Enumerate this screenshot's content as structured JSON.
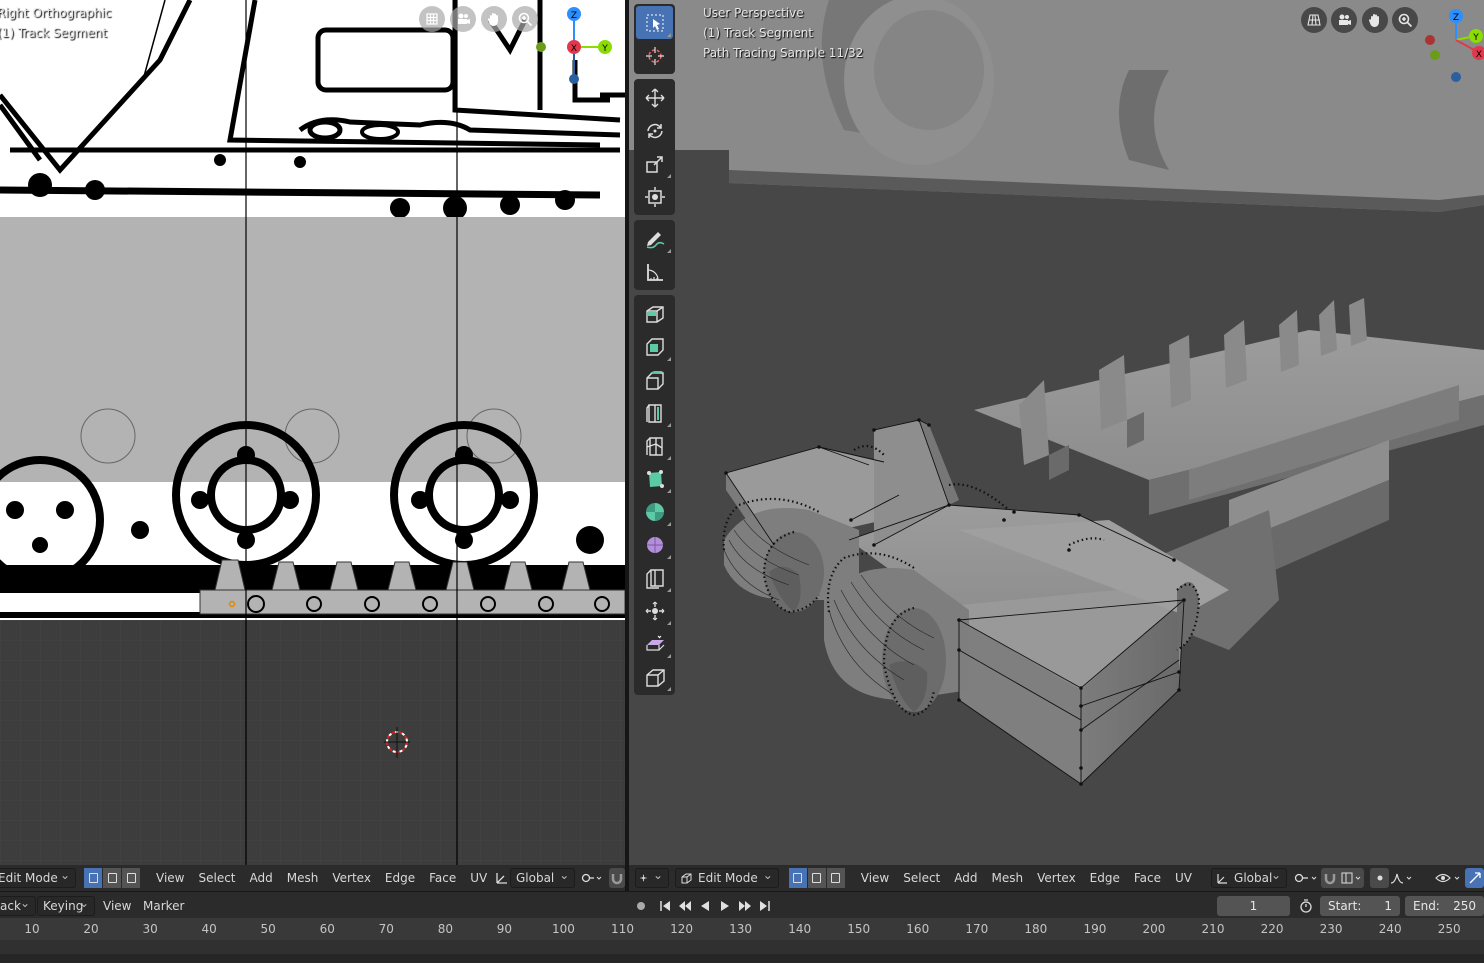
{
  "left_viewport": {
    "view_name": "Right Orthographic",
    "object_name": "(1) Track Segment",
    "nav_buttons": [
      "grid-icon",
      "camera-icon",
      "hand-icon",
      "zoom-icon"
    ],
    "gizmo_axes": [
      "Z",
      "X",
      "Y"
    ]
  },
  "right_viewport": {
    "view_name": "User Perspective",
    "object_name": "(1) Track Segment",
    "render_status": "Path Tracing Sample 11/32",
    "nav_buttons": [
      "grid-icon",
      "camera-icon",
      "hand-icon",
      "zoom-icon"
    ],
    "gizmo_axes": [
      "Z",
      "Y",
      "X"
    ]
  },
  "toolbar": {
    "tools": [
      "select-box",
      "cursor",
      "move",
      "rotate",
      "scale",
      "transform",
      "annotate",
      "measure",
      "add-cube",
      "extrude",
      "inset",
      "bevel",
      "loop-cut",
      "knife",
      "poly-build",
      "spin",
      "smooth",
      "edge-slide",
      "shrink-fatten",
      "shear",
      "rip-region"
    ],
    "active_tool": "select-box"
  },
  "left_header": {
    "mode": "Edit Mode",
    "menus": [
      "View",
      "Select",
      "Add",
      "Mesh",
      "Vertex",
      "Edge",
      "Face",
      "UV"
    ],
    "transform_orientation": "Global"
  },
  "right_header": {
    "mode": "Edit Mode",
    "menus": [
      "View",
      "Select",
      "Add",
      "Mesh",
      "Vertex",
      "Edge",
      "Face",
      "UV"
    ],
    "transform_orientation": "Global"
  },
  "timeline": {
    "playback_label": "ack",
    "keying_label": "Keying",
    "view_label": "View",
    "marker_label": "Marker",
    "current_frame": "1",
    "start_label": "Start:",
    "start_value": "1",
    "end_label": "End:",
    "end_value": "250",
    "ruler_ticks": [
      "10",
      "20",
      "30",
      "40",
      "50",
      "60",
      "70",
      "80",
      "90",
      "100",
      "110",
      "120",
      "130",
      "140",
      "150",
      "160",
      "170",
      "180",
      "190",
      "200",
      "210",
      "220",
      "230",
      "240",
      "250"
    ]
  },
  "colors": {
    "accent": "#4772b3",
    "axis_x": "#e2384c",
    "axis_y": "#8bdc00",
    "axis_z": "#2c8fff",
    "header_bg": "#2b2b2b",
    "viewport_bg": "#474747"
  }
}
